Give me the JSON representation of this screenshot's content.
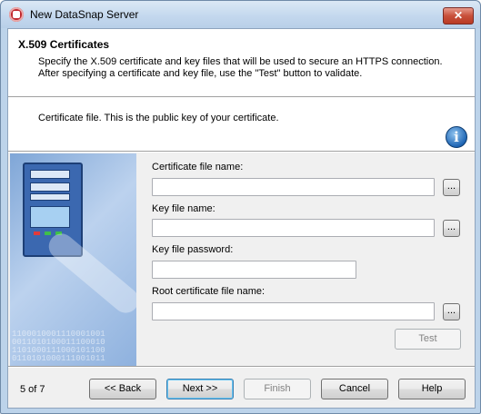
{
  "window": {
    "title": "New DataSnap Server",
    "close_label": "✕"
  },
  "header": {
    "title": "X.509 Certificates",
    "description_line1": "Specify the X.509 certificate and key files that will be used to secure an HTTPS connection.",
    "description_line2": "After specifying a certificate and key file, use the \"Test\" button to validate."
  },
  "info": {
    "text": "Certificate file.  This is the public key of your certificate.",
    "icon_glyph": "i"
  },
  "side_image": {
    "binary_text": "1100010001110001001\n0011010100011100010\n1101000111000101100\n0110101000111001011"
  },
  "form": {
    "cert_label": "Certificate file name:",
    "cert_value": "",
    "key_label": "Key file name:",
    "key_value": "",
    "password_label": "Key file password:",
    "password_value": "",
    "root_label": "Root certificate file name:",
    "root_value": "",
    "browse_label": "...",
    "test_label": "Test"
  },
  "footer": {
    "page_indicator": "5 of 7",
    "back_label": "<< Back",
    "next_label": "Next >>",
    "finish_label": "Finish",
    "cancel_label": "Cancel",
    "help_label": "Help"
  },
  "colors": {
    "title_bar": "#c4d8ee",
    "close_button": "#c8503b",
    "info_icon": "#1f66b5"
  }
}
